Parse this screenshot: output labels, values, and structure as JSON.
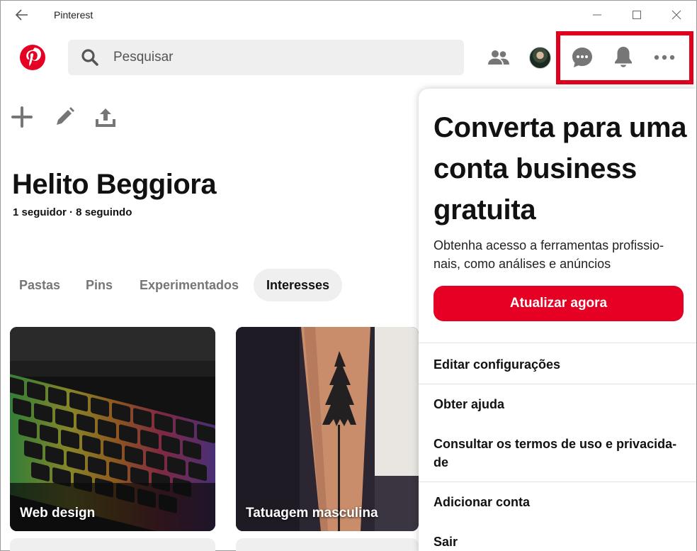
{
  "window": {
    "title": "Pinterest"
  },
  "search": {
    "placeholder": "Pesquisar"
  },
  "profile": {
    "name": "Helito Beggiora",
    "stats": "1 seguidor · 8 seguindo"
  },
  "tabs": [
    {
      "label": "Pastas",
      "active": false
    },
    {
      "label": "Pins",
      "active": false
    },
    {
      "label": "Experimentados",
      "active": false
    },
    {
      "label": "Interesses",
      "active": true
    }
  ],
  "cards": [
    {
      "label": "Web design"
    },
    {
      "label": "Tatuagem masculina"
    }
  ],
  "menu": {
    "heading": "Converta para uma conta business gratuita",
    "description": "Obtenha acesso a ferramentas profissio-nais, como análises e anúncios",
    "cta_label": "Atualizar agora",
    "items": [
      {
        "label": "Editar configurações"
      },
      {
        "label": "Obter ajuda"
      },
      {
        "label": "Consultar os termos de uso e privacida-de"
      },
      {
        "label": "Adicionar conta"
      },
      {
        "label": "Sair"
      }
    ]
  },
  "icons": {
    "logo": "pinterest-logo",
    "people": "people-icon",
    "chat": "chat-icon",
    "bell": "bell-icon",
    "more": "more-icon",
    "plus": "plus-icon",
    "pencil": "pencil-icon",
    "upload": "upload-icon"
  },
  "colors": {
    "brand": "#e60023",
    "highlight": "#e0001b",
    "tab_active_bg": "#efefef",
    "icon_gray": "#767676"
  }
}
